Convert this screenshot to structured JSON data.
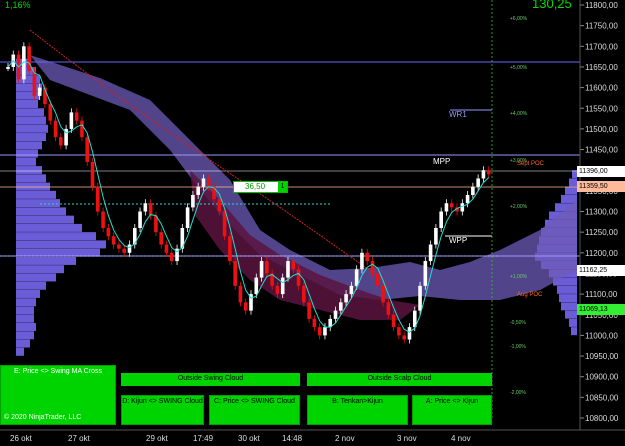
{
  "header": {
    "pct_change": "1,16%",
    "big_value": "130,25"
  },
  "price_axis": {
    "labels": [
      "11800,00",
      "11750,00",
      "11700,00",
      "11650,00",
      "11600,00",
      "11550,00",
      "11500,00",
      "11450,00",
      "11400,00",
      "11350,00",
      "11300,00",
      "11250,00",
      "11200,00",
      "11150,00",
      "11100,00",
      "11050,00",
      "11000,00",
      "10950,00",
      "10900,00",
      "10850,00",
      "10800,00"
    ],
    "values": [
      11800,
      11750,
      11700,
      11650,
      11600,
      11550,
      11500,
      11450,
      11400,
      11350,
      11300,
      11250,
      11200,
      11150,
      11100,
      11050,
      11000,
      10950,
      10900,
      10850,
      10800
    ]
  },
  "pct_scale": {
    "labels": [
      "+6,00%",
      "+5,00%",
      "+4,00%",
      "+3,00%",
      "+2,00%",
      "+1,00%",
      "-0,50%",
      "-0,50%",
      "-1,00%",
      "-2,00%"
    ]
  },
  "price_tags": {
    "p1": "11396,00",
    "p2": "11359,50",
    "p3": "11162,25",
    "p4": "11069,13"
  },
  "time_axis": [
    "26 okt",
    "27 okt",
    "29 okt",
    "17:49",
    "30 okt",
    "14:48",
    "2 nov",
    "3 nov",
    "4 nov"
  ],
  "annotations": {
    "wr1": "WR1",
    "mpp": "MPP",
    "wpp": "WPP",
    "sept_poc": "Sept POC",
    "aug_poc": "Aug POC",
    "counter_value": "36,50",
    "counter_step": "1",
    "copyright": "© 2020 NinjaTrader, LLC"
  },
  "panel": {
    "main_label": "E: Price <> Swing MA Cross",
    "swing_header": "Outside Swing Cloud",
    "scalp_header": "Outside Scalp Cloud",
    "btn_d": "D: Kijun <> SWING Cloud",
    "btn_c": "C: Price <> SWING Cloud",
    "btn_b": "B: Tenkan>Kijun",
    "btn_a": "A: Price <> Kijun"
  },
  "colors": {
    "bull": "#ffffff",
    "bear": "#ee1111",
    "cloud_swing": "#6e5bb8",
    "cloud_scalp": "#5a1440",
    "accent_green": "#00d400",
    "volume_profile": "#7766ee",
    "tenkan": "#22ddcc"
  }
}
